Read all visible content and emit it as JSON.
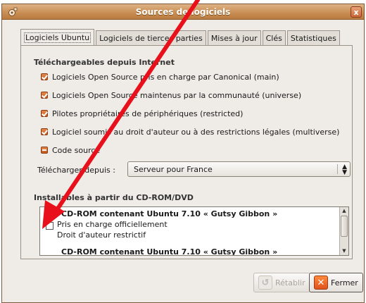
{
  "window": {
    "title": "Sources de logiciels",
    "close_label": "x"
  },
  "tabs": [
    {
      "label": "Logiciels Ubuntu",
      "active": true
    },
    {
      "label": "Logiciels de tierces parties",
      "active": false
    },
    {
      "label": "Mises à jour",
      "active": false
    },
    {
      "label": "Clés",
      "active": false
    },
    {
      "label": "Statistiques",
      "active": false
    }
  ],
  "internet": {
    "title": "Téléchargeables depuis Internet",
    "items": [
      {
        "label": "Logiciels Open Source pris en charge par Canonical (main)",
        "state": "checked"
      },
      {
        "label": "Logiciels Open Source maintenus par la communauté (universe)",
        "state": "checked"
      },
      {
        "label": "Pilotes propriétaires de périphériques (restricted)",
        "state": "checked"
      },
      {
        "label": "Logiciel soumis au droit d'auteur ou à des restrictions légales (multiverse)",
        "state": "checked"
      },
      {
        "label": "Code source",
        "state": "mixed"
      }
    ],
    "download_label": "Télécharger depuis :",
    "download_value": "Serveur pour France"
  },
  "cdrom": {
    "title": "Installables à partir du CD-ROM/DVD",
    "entries": [
      {
        "title": "CD-ROM contenant Ubuntu 7.10 « Gutsy Gibbon »",
        "line1": "Pris en charge officiellement",
        "line2": "Droit d'auteur restrictif",
        "checked": false
      },
      {
        "title": "CD-ROM contenant Ubuntu 7.10 « Gutsy Gibbon »"
      }
    ]
  },
  "buttons": {
    "revert": "Rétablir",
    "close": "Fermer"
  },
  "annotation": {
    "arrow_color": "#e8101a"
  }
}
